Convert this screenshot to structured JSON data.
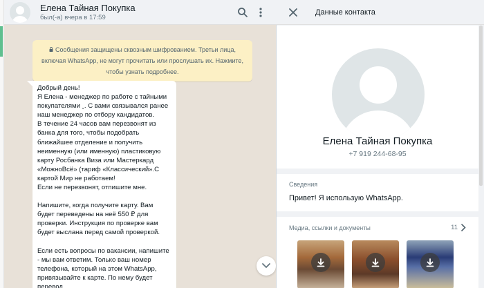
{
  "chat": {
    "contact_name": "Елена Тайная Покупка",
    "last_seen": "был(-а) вчера в 17:59",
    "encryption_notice": "Сообщения защищены сквозным шифрованием. Третьи лица, включая WhatsApp, не могут прочитать или прослушать их. Нажмите, чтобы узнать подробнее.",
    "message_paragraphs": [
      "Добрый день!\nЯ Елена - менеджер по работе с тайными покупателями ¸. С вами связывался ранее наш менеджер по отбору кандидатов.\nВ течение 24 часов вам перезвонят из банка для того, чтобы подобрать ближайшее отделение и получить неименную (или именную) пластиковую карту Росбанка Виза или Мастеркард «МожноВсё» (тариф «Классический».С картой Мир не работаем!\nЕсли не перезвонят, отпишите мне.",
      "Напишите, когда получите карту. Вам будет переведены на неё 550 ₽ для проверки. Инструкция по проверке вам будет выслана перед самой проверкой.",
      "Если есть вопросы по вакансии, напишите - мы вам ответим. Только ваш номер телефона, который на этом WhatsApp, привязывайте к карте. По нему будет перевод."
    ]
  },
  "icons": {
    "search": "search-icon",
    "menu": "menu-icon",
    "close": "close-icon",
    "scroll_down": "chevron-down-icon",
    "chevron_right": "chevron-right-icon",
    "download": "download-icon",
    "lock": "lock-icon"
  },
  "contact_info": {
    "header_title": "Данные контакта",
    "name": "Елена Тайная Покупка",
    "phone": "+7 919 244-68-95",
    "about_label": "Сведения",
    "about_text": "Привет! Я использую WhatsApp.",
    "media_label": "Медиа, ссылки и документы",
    "media_count": "11"
  },
  "colors": {
    "chat_background": "#e8e1d8",
    "notice_background": "#fcf0c5",
    "panel_background": "#f0f2f5"
  }
}
